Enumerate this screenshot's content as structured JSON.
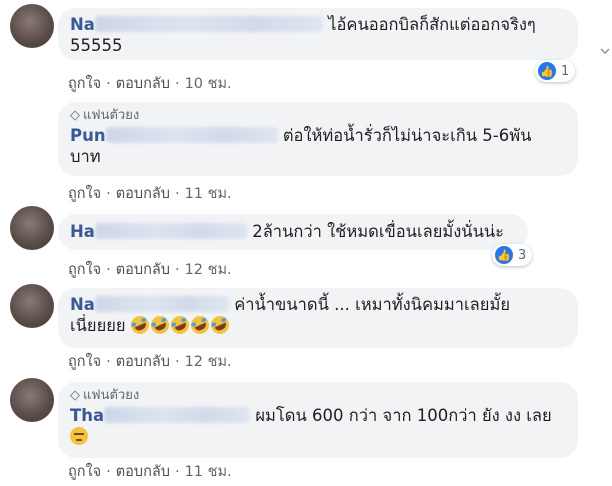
{
  "comments": [
    {
      "fan_badge": "",
      "name": "Na",
      "text": "ไอ้คนออกบิลก็สักแต่ออกจริงๆ 55555",
      "text_line1": "ไอ้คนออกบิลก็สักแต่ออกจริงๆ",
      "text_line2": "55555",
      "like": "ถูกใจ",
      "reply": "ตอบกลับ",
      "time": "10 ชม.",
      "reaction_count": "1"
    },
    {
      "fan_badge": "แฟนตัวยง",
      "name": "Pun",
      "text_line1": "ต่อให้ท่อน้ำรั่วก็ไม่น่าจะเกิน 5-6พัน",
      "text_line2": "บาท",
      "like": "ถูกใจ",
      "reply": "ตอบกลับ",
      "time": "11 ชม."
    },
    {
      "name": "Ha",
      "text_line1": "2ล้านกว่า ใช้หมดเขื่อนเลยมั้งนั่นน่ะ",
      "like": "ถูกใจ",
      "reply": "ตอบกลับ",
      "time": "12 ชม.",
      "reaction_count": "3"
    },
    {
      "name": "Na",
      "text_line1": "ค่าน้ำขนาดนี้ ... เหมาทั้งนิคมมาเลยมั้ย",
      "text_line2": "เนี่ยยยย",
      "like": "ถูกใจ",
      "reply": "ตอบกลับ",
      "time": "12 ชม."
    },
    {
      "fan_badge": "แฟนตัวยง",
      "name": "Tha",
      "text_line1": "ผมโดน 600 กว่า จาก 100กว่า ยัง งง เลย",
      "like": "ถูกใจ",
      "reply": "ตอบกลับ",
      "time": "11 ชม."
    }
  ],
  "icons": {
    "fan": "diamond-icon",
    "reaction": "like-thumb-icon",
    "emoji_rofl": "rolling-on-floor-laughing-emoji",
    "emoji_unamused": "unamused-face-emoji"
  },
  "colors": {
    "name": "#385898",
    "bubble": "#f2f3f5",
    "like_badge": "#2078f4",
    "meta": "#606770"
  }
}
